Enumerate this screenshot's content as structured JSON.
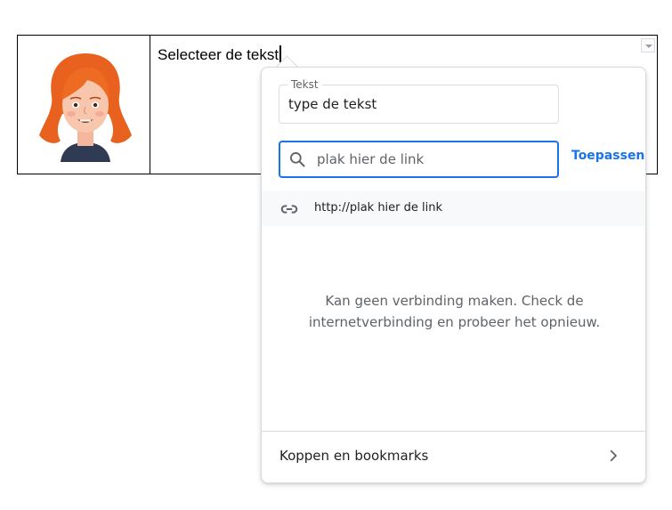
{
  "document": {
    "cell_text": "Selecteer de tekst"
  },
  "link_popup": {
    "text_field": {
      "label": "Tekst",
      "value": "type de tekst"
    },
    "link_field": {
      "placeholder": "plak hier de link"
    },
    "apply_label": "Toepassen",
    "suggestion": {
      "icon": "link-icon",
      "text": "http://plak hier de link"
    },
    "error_message": "Kan geen verbinding maken. Check de internetverbinding en probeer het opnieuw.",
    "footer": {
      "label": "Koppen en bookmarks",
      "icon": "chevron-right-icon"
    }
  },
  "colors": {
    "accent": "#1a73e8",
    "border": "#dadce0",
    "secondary_text": "#5f6368",
    "hair": "#e8611e"
  }
}
